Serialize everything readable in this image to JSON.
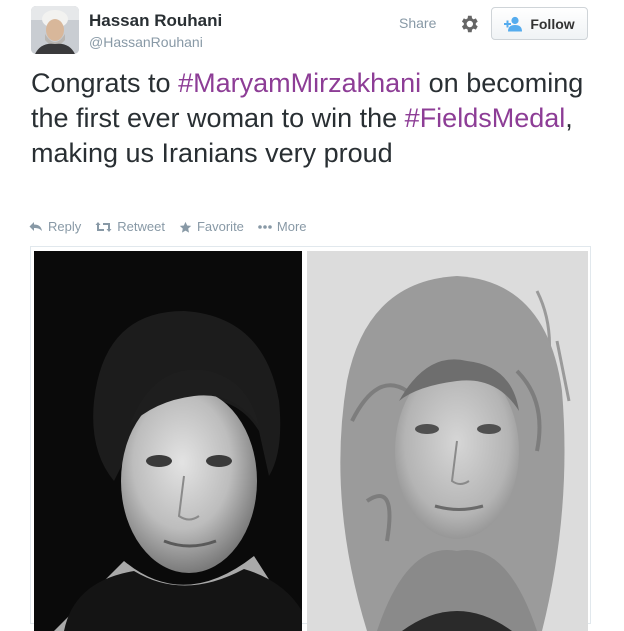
{
  "tweet": {
    "author_name": "Hassan Rouhani",
    "author_handle": "@HassanRouhani",
    "share_label": "Share",
    "follow_label": "Follow",
    "text_segments": [
      {
        "text": "Congrats to ",
        "hashtag": false
      },
      {
        "text": "#MaryamMirzakhani",
        "hashtag": true
      },
      {
        "text": " on becoming the first ever woman to win the ",
        "hashtag": false
      },
      {
        "text": "#FieldsMedal",
        "hashtag": true
      },
      {
        "text": ", making us Iranians very proud",
        "hashtag": false
      }
    ],
    "actions": [
      {
        "label": "Reply",
        "icon": "reply-icon"
      },
      {
        "label": "Retweet",
        "icon": "retweet-icon"
      },
      {
        "label": "Favorite",
        "icon": "star-icon"
      },
      {
        "label": "More",
        "icon": "more-dots-icon"
      }
    ]
  },
  "colors": {
    "hashtag": "#8d3d96",
    "text": "#292f33",
    "muted": "#8899a6",
    "follow_icon": "#55acee"
  }
}
